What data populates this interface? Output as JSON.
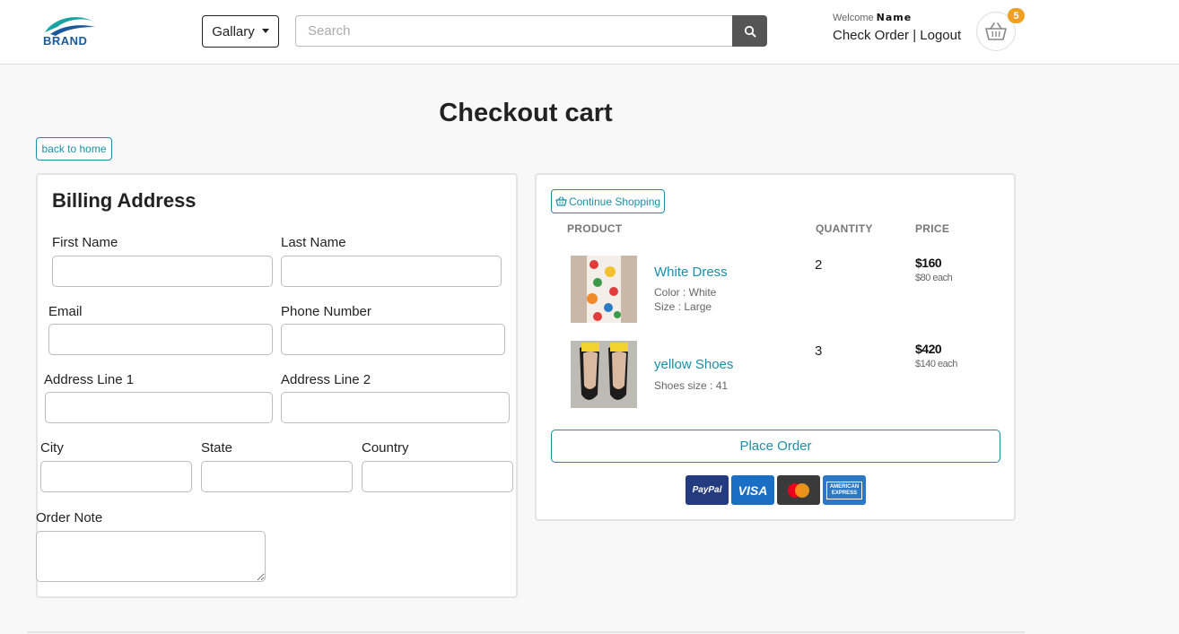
{
  "header": {
    "brand_text": "BRAND",
    "gallery_label": "Gallary",
    "search_placeholder": "Search",
    "welcome_label": "Welcome",
    "user_name": "Name",
    "check_order_label": "Check Order",
    "separator": "|",
    "logout_label": "Logout",
    "cart_count": "5"
  },
  "page": {
    "title": "Checkout cart",
    "back_label": "back to home"
  },
  "billing": {
    "title": "Billing Address",
    "first_name_label": "First Name",
    "last_name_label": "Last Name",
    "email_label": "Email",
    "phone_label": "Phone Number",
    "address1_label": "Address Line 1",
    "address2_label": "Address Line 2",
    "city_label": "City",
    "state_label": "State",
    "country_label": "Country",
    "order_note_label": "Order Note"
  },
  "cart": {
    "continue_label": "Continue Shopping",
    "col_product": "PRODUCT",
    "col_quantity": "QUANTITY",
    "col_price": "PRICE",
    "items": [
      {
        "name": "White Dress",
        "attr1": "Color : White",
        "attr2": "Size : Large",
        "quantity": "2",
        "total": "$160",
        "each": "$80 each"
      },
      {
        "name": "yellow Shoes",
        "attr1": "Shoes size : 41",
        "quantity": "3",
        "total": "$420",
        "each": "$140 each"
      }
    ],
    "place_order_label": "Place Order",
    "payment_methods": [
      "PayPal",
      "VISA",
      "mastercard-icon",
      "AMERICAN EXPRESS"
    ]
  },
  "colors": {
    "accent": "#1a8fa8",
    "badge": "#f0a020",
    "paypal": "#253b80",
    "visa": "#1a6fc4",
    "mastercard": "#3a3a3a",
    "amex": "#2a78c6"
  }
}
